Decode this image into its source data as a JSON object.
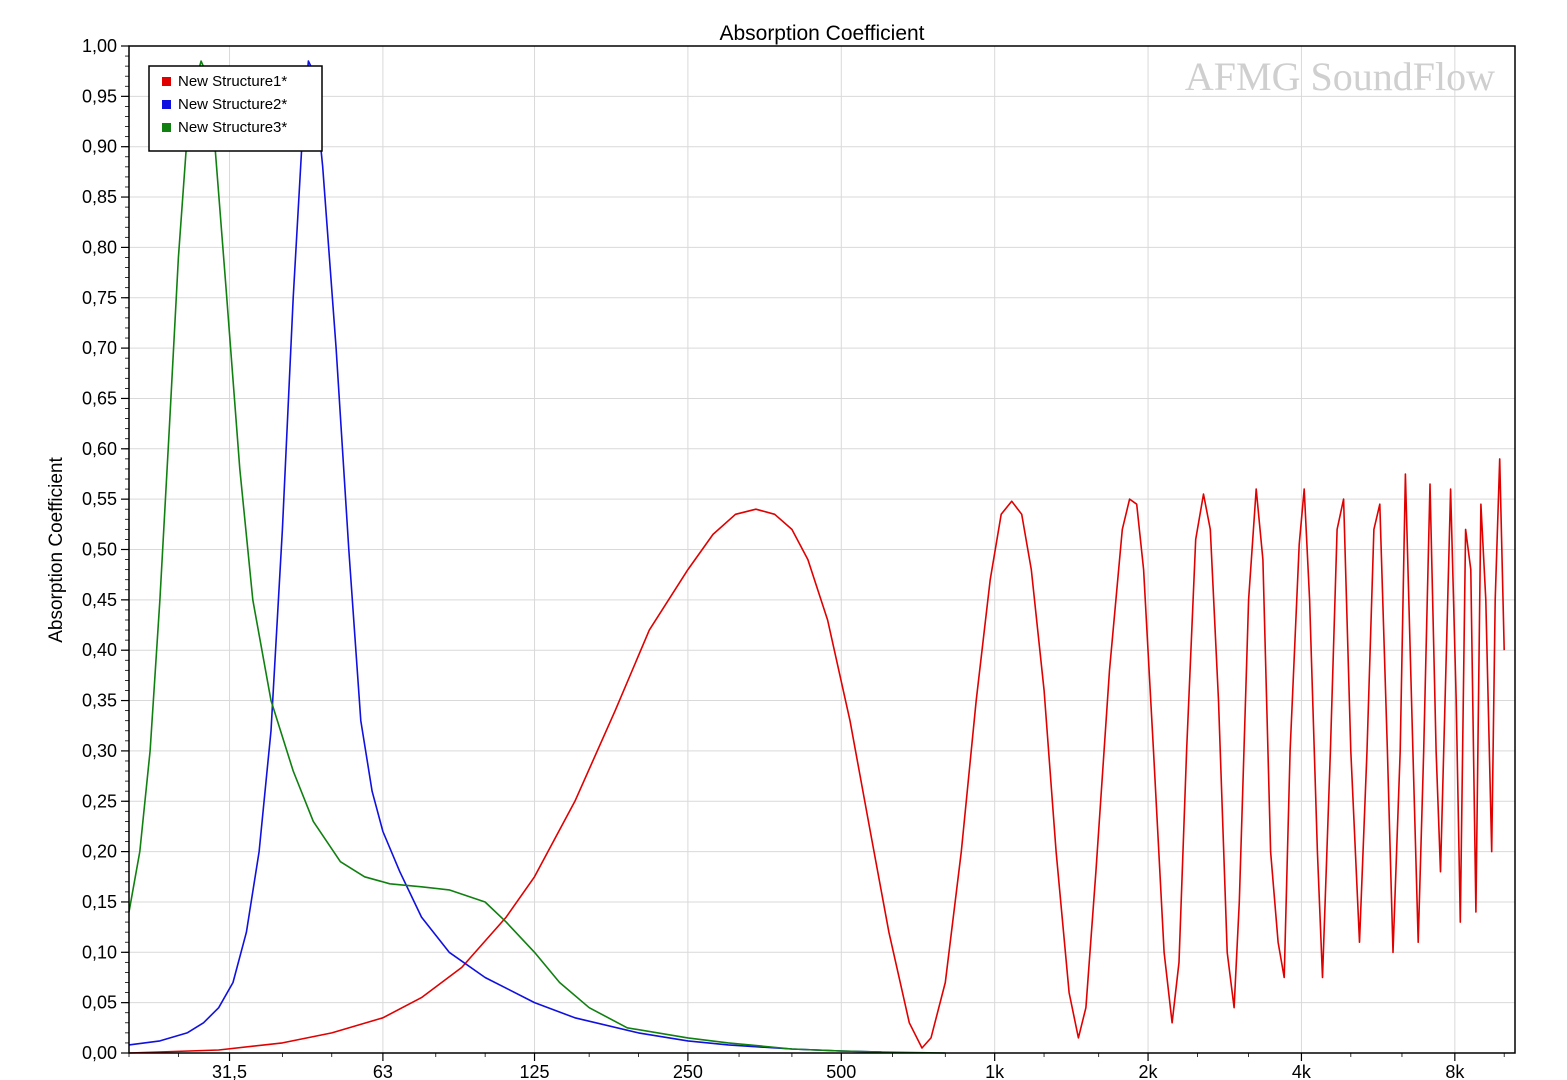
{
  "chart_data": {
    "type": "line",
    "title": "Absorption Coefficient",
    "xlabel": "",
    "ylabel": "Absorption Coefficient",
    "x_scale": "log",
    "xlim": [
      20,
      10500
    ],
    "ylim": [
      0,
      1
    ],
    "grid": true,
    "legend_position": "top-left",
    "watermark": "AFMG SoundFlow",
    "x_ticks": [
      {
        "value": 31.5,
        "label": "31,5"
      },
      {
        "value": 63,
        "label": "63"
      },
      {
        "value": 125,
        "label": "125"
      },
      {
        "value": 250,
        "label": "250"
      },
      {
        "value": 500,
        "label": "500"
      },
      {
        "value": 1000,
        "label": "1k"
      },
      {
        "value": 2000,
        "label": "2k"
      },
      {
        "value": 4000,
        "label": "4k"
      },
      {
        "value": 8000,
        "label": "8k"
      }
    ],
    "y_ticks": [
      {
        "value": 0.0,
        "label": "0,00"
      },
      {
        "value": 0.05,
        "label": "0,05"
      },
      {
        "value": 0.1,
        "label": "0,10"
      },
      {
        "value": 0.15,
        "label": "0,15"
      },
      {
        "value": 0.2,
        "label": "0,20"
      },
      {
        "value": 0.25,
        "label": "0,25"
      },
      {
        "value": 0.3,
        "label": "0,30"
      },
      {
        "value": 0.35,
        "label": "0,35"
      },
      {
        "value": 0.4,
        "label": "0,40"
      },
      {
        "value": 0.45,
        "label": "0,45"
      },
      {
        "value": 0.5,
        "label": "0,50"
      },
      {
        "value": 0.55,
        "label": "0,55"
      },
      {
        "value": 0.6,
        "label": "0,60"
      },
      {
        "value": 0.65,
        "label": "0,65"
      },
      {
        "value": 0.7,
        "label": "0,70"
      },
      {
        "value": 0.75,
        "label": "0,75"
      },
      {
        "value": 0.8,
        "label": "0,80"
      },
      {
        "value": 0.85,
        "label": "0,85"
      },
      {
        "value": 0.9,
        "label": "0,90"
      },
      {
        "value": 0.95,
        "label": "0,95"
      },
      {
        "value": 1.0,
        "label": "1,00"
      }
    ],
    "series": [
      {
        "name": "New Structure1*",
        "color": "#e00000",
        "points": [
          [
            20,
            0.0
          ],
          [
            30,
            0.003
          ],
          [
            40,
            0.01
          ],
          [
            50,
            0.02
          ],
          [
            63,
            0.035
          ],
          [
            75,
            0.055
          ],
          [
            90,
            0.085
          ],
          [
            110,
            0.135
          ],
          [
            125,
            0.175
          ],
          [
            150,
            0.25
          ],
          [
            180,
            0.34
          ],
          [
            210,
            0.42
          ],
          [
            250,
            0.48
          ],
          [
            280,
            0.515
          ],
          [
            310,
            0.535
          ],
          [
            340,
            0.54
          ],
          [
            370,
            0.535
          ],
          [
            400,
            0.52
          ],
          [
            430,
            0.49
          ],
          [
            470,
            0.43
          ],
          [
            520,
            0.33
          ],
          [
            570,
            0.22
          ],
          [
            620,
            0.12
          ],
          [
            680,
            0.03
          ],
          [
            720,
            0.005
          ],
          [
            750,
            0.015
          ],
          [
            800,
            0.07
          ],
          [
            860,
            0.2
          ],
          [
            920,
            0.35
          ],
          [
            980,
            0.47
          ],
          [
            1030,
            0.535
          ],
          [
            1080,
            0.548
          ],
          [
            1130,
            0.535
          ],
          [
            1180,
            0.48
          ],
          [
            1250,
            0.36
          ],
          [
            1320,
            0.2
          ],
          [
            1400,
            0.06
          ],
          [
            1460,
            0.015
          ],
          [
            1510,
            0.045
          ],
          [
            1580,
            0.18
          ],
          [
            1680,
            0.38
          ],
          [
            1780,
            0.52
          ],
          [
            1840,
            0.55
          ],
          [
            1900,
            0.545
          ],
          [
            1960,
            0.48
          ],
          [
            2050,
            0.3
          ],
          [
            2150,
            0.1
          ],
          [
            2230,
            0.03
          ],
          [
            2300,
            0.09
          ],
          [
            2380,
            0.3
          ],
          [
            2480,
            0.51
          ],
          [
            2570,
            0.555
          ],
          [
            2650,
            0.52
          ],
          [
            2750,
            0.35
          ],
          [
            2860,
            0.1
          ],
          [
            2950,
            0.045
          ],
          [
            3020,
            0.15
          ],
          [
            3150,
            0.45
          ],
          [
            3260,
            0.56
          ],
          [
            3360,
            0.49
          ],
          [
            3480,
            0.2
          ],
          [
            3600,
            0.11
          ],
          [
            3700,
            0.075
          ],
          [
            3800,
            0.3
          ],
          [
            3960,
            0.505
          ],
          [
            4050,
            0.56
          ],
          [
            4150,
            0.45
          ],
          [
            4300,
            0.2
          ],
          [
            4400,
            0.075
          ],
          [
            4560,
            0.3
          ],
          [
            4700,
            0.52
          ],
          [
            4840,
            0.55
          ],
          [
            5000,
            0.3
          ],
          [
            5200,
            0.11
          ],
          [
            5380,
            0.3
          ],
          [
            5550,
            0.52
          ],
          [
            5700,
            0.545
          ],
          [
            5900,
            0.3
          ],
          [
            6050,
            0.1
          ],
          [
            6250,
            0.3
          ],
          [
            6400,
            0.575
          ],
          [
            6620,
            0.3
          ],
          [
            6780,
            0.11
          ],
          [
            6950,
            0.3
          ],
          [
            7150,
            0.565
          ],
          [
            7350,
            0.3
          ],
          [
            7500,
            0.18
          ],
          [
            7700,
            0.4
          ],
          [
            7850,
            0.56
          ],
          [
            8050,
            0.35
          ],
          [
            8200,
            0.13
          ],
          [
            8400,
            0.52
          ],
          [
            8600,
            0.48
          ],
          [
            8800,
            0.14
          ],
          [
            9000,
            0.545
          ],
          [
            9200,
            0.45
          ],
          [
            9450,
            0.2
          ],
          [
            9600,
            0.45
          ],
          [
            9800,
            0.59
          ],
          [
            10000,
            0.4
          ]
        ]
      },
      {
        "name": "New Structure2*",
        "color": "#1010e0",
        "points": [
          [
            20,
            0.008
          ],
          [
            23,
            0.012
          ],
          [
            26,
            0.02
          ],
          [
            28,
            0.03
          ],
          [
            30,
            0.045
          ],
          [
            32,
            0.07
          ],
          [
            34,
            0.12
          ],
          [
            36,
            0.2
          ],
          [
            38,
            0.32
          ],
          [
            40,
            0.52
          ],
          [
            42,
            0.75
          ],
          [
            44,
            0.93
          ],
          [
            45,
            0.985
          ],
          [
            46,
            0.975
          ],
          [
            48,
            0.88
          ],
          [
            51,
            0.7
          ],
          [
            54,
            0.5
          ],
          [
            57,
            0.33
          ],
          [
            60,
            0.26
          ],
          [
            63,
            0.22
          ],
          [
            68,
            0.18
          ],
          [
            75,
            0.135
          ],
          [
            85,
            0.1
          ],
          [
            100,
            0.075
          ],
          [
            125,
            0.05
          ],
          [
            150,
            0.035
          ],
          [
            200,
            0.02
          ],
          [
            250,
            0.012
          ],
          [
            300,
            0.008
          ],
          [
            400,
            0.004
          ],
          [
            500,
            0.002
          ],
          [
            600,
            0.001
          ]
        ]
      },
      {
        "name": "New Structure3*",
        "color": "#108010",
        "points": [
          [
            20,
            0.14
          ],
          [
            21,
            0.2
          ],
          [
            22,
            0.3
          ],
          [
            23,
            0.45
          ],
          [
            24,
            0.62
          ],
          [
            25,
            0.79
          ],
          [
            26,
            0.91
          ],
          [
            27,
            0.965
          ],
          [
            27.7,
            0.985
          ],
          [
            28.5,
            0.97
          ],
          [
            29.5,
            0.9
          ],
          [
            31,
            0.76
          ],
          [
            33,
            0.58
          ],
          [
            35,
            0.45
          ],
          [
            38,
            0.35
          ],
          [
            42,
            0.28
          ],
          [
            46,
            0.23
          ],
          [
            52,
            0.19
          ],
          [
            58,
            0.175
          ],
          [
            65,
            0.168
          ],
          [
            75,
            0.165
          ],
          [
            85,
            0.162
          ],
          [
            100,
            0.15
          ],
          [
            110,
            0.13
          ],
          [
            125,
            0.1
          ],
          [
            140,
            0.07
          ],
          [
            160,
            0.045
          ],
          [
            190,
            0.025
          ],
          [
            250,
            0.015
          ],
          [
            300,
            0.01
          ],
          [
            400,
            0.004
          ],
          [
            500,
            0.002
          ],
          [
            600,
            0.001
          ],
          [
            800,
            0.0
          ]
        ]
      }
    ]
  }
}
